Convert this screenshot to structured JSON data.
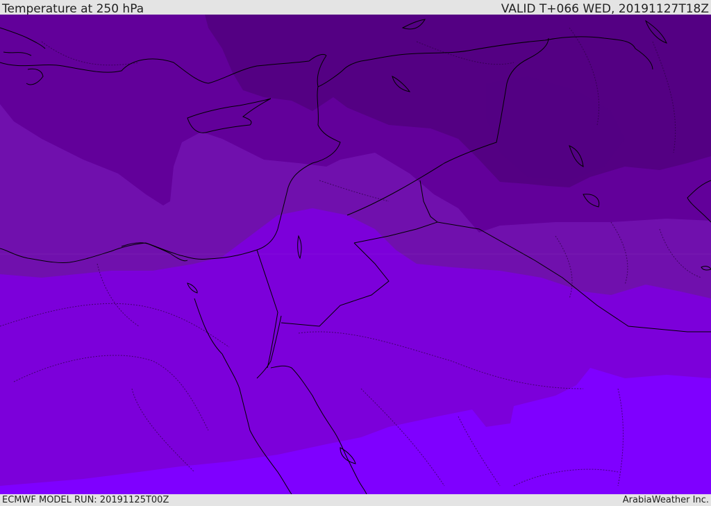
{
  "header": {
    "title": "Temperature at 250 hPa",
    "valid": "VALID T+066 WED, 20191127T18Z"
  },
  "footer": {
    "model_run": "ECMWF MODEL RUN: 20191125T00Z",
    "credit": "ArabiaWeather Inc."
  },
  "colors": {
    "darkest": "#540083",
    "dark": "#62009a",
    "mid": "#7010ad",
    "light": "#7c00da",
    "lightest": "#7f00ff",
    "coastline": "#000000",
    "topbar": "#e4e4e4"
  }
}
